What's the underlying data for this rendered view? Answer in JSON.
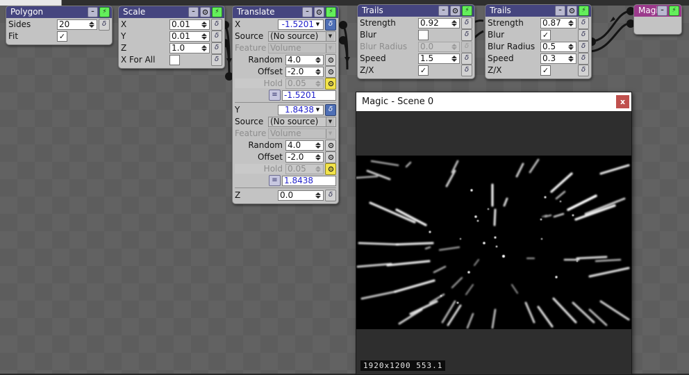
{
  "app": {
    "background": "#5d5d5d",
    "header_color": "#45457f",
    "magic_header_color": "#9b3a8c",
    "accent_green": "#63ef5a"
  },
  "nodes": {
    "polygon": {
      "title": "Polygon",
      "buttons": {
        "minimize": "–",
        "bolt": "⚡"
      },
      "rows": [
        {
          "label": "Sides",
          "value": "20"
        },
        {
          "label": "Fit",
          "checked": "✓"
        }
      ]
    },
    "scale": {
      "title": "Scale",
      "buttons": {
        "minimize": "–",
        "reset": "○",
        "bolt": "⚡"
      },
      "rows": [
        {
          "label": "X",
          "value": "0.01"
        },
        {
          "label": "Y",
          "value": "0.01"
        },
        {
          "label": "Z",
          "value": "1.0"
        },
        {
          "label": "X For All",
          "checked": ""
        }
      ]
    },
    "translate": {
      "title": "Translate",
      "buttons": {
        "minimize": "–",
        "reset": "○",
        "bolt": "⚡"
      },
      "x": {
        "label": "X",
        "value": "-1.5201",
        "source_label": "Source",
        "source_value": "(No source)",
        "feature_label": "Feature",
        "feature_value": "Volume",
        "random_label": "Random",
        "random_value": "4.0",
        "offset_label": "Offset",
        "offset_value": "-2.0",
        "hold_label": "Hold",
        "hold_value": "0.05",
        "result_value": "-1.5201"
      },
      "y": {
        "label": "Y",
        "value": "1.8438",
        "source_label": "Source",
        "source_value": "(No source)",
        "feature_label": "Feature",
        "feature_value": "Volume",
        "random_label": "Random",
        "random_value": "4.0",
        "offset_label": "Offset",
        "offset_value": "-2.0",
        "hold_label": "Hold",
        "hold_value": "0.05",
        "result_value": "1.8438"
      },
      "z": {
        "label": "Z",
        "value": "0.0"
      }
    },
    "trails1": {
      "title": "Trails",
      "buttons": {
        "minimize": "–",
        "reset": "○",
        "bolt": "⚡"
      },
      "rows": [
        {
          "label": "Strength",
          "value": "0.92",
          "type": "number"
        },
        {
          "label": "Blur",
          "checked": "",
          "type": "check"
        },
        {
          "label": "Blur Radius",
          "value": "0.0",
          "type": "number",
          "disabled": true
        },
        {
          "label": "Speed",
          "value": "1.5",
          "type": "number"
        },
        {
          "label": "Z/X",
          "checked": "✓",
          "type": "check"
        }
      ]
    },
    "trails2": {
      "title": "Trails",
      "buttons": {
        "minimize": "–",
        "reset": "○",
        "bolt": "⚡"
      },
      "rows": [
        {
          "label": "Strength",
          "value": "0.87",
          "type": "number"
        },
        {
          "label": "Blur",
          "checked": "✓",
          "type": "check"
        },
        {
          "label": "Blur Radius",
          "value": "0.5",
          "type": "number"
        },
        {
          "label": "Speed",
          "value": "0.3",
          "type": "number"
        },
        {
          "label": "Z/X",
          "checked": "✓",
          "type": "check"
        }
      ]
    },
    "magic": {
      "title": "Magic",
      "buttons": {
        "minimize": "–",
        "bolt": "⚡"
      }
    }
  },
  "preview": {
    "title": "Magic - Scene 0",
    "close_label": "x",
    "resolution": "1920x1200 553.1"
  }
}
